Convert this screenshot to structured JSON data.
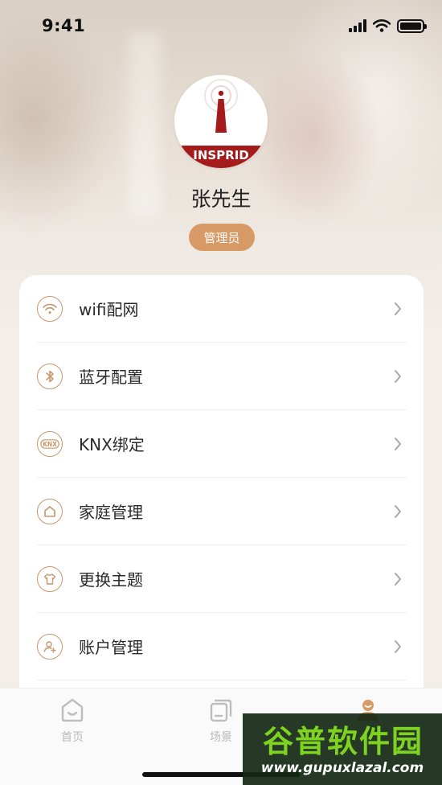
{
  "status_bar": {
    "time": "9:41"
  },
  "profile": {
    "avatar_logo_text": "INSPRID",
    "name": "张先生",
    "role": "管理员"
  },
  "menu": {
    "items": [
      {
        "label": "wifi配网",
        "icon": "wifi-icon"
      },
      {
        "label": "蓝牙配置",
        "icon": "bluetooth-icon"
      },
      {
        "label": "KNX绑定",
        "icon": "knx-icon"
      },
      {
        "label": "家庭管理",
        "icon": "home-icon"
      },
      {
        "label": "更换主题",
        "icon": "shirt-icon"
      },
      {
        "label": "账户管理",
        "icon": "user-add-icon"
      }
    ]
  },
  "tab_bar": {
    "tabs": [
      {
        "label": "首页",
        "icon": "home-tab-icon"
      },
      {
        "label": "场景",
        "icon": "scene-tab-icon"
      },
      {
        "label": "",
        "icon": "profile-tab-icon"
      }
    ]
  },
  "watermark": {
    "title": "谷普软件园",
    "url": "www.gupuxlazal.com"
  },
  "colors": {
    "accent": "#d79a66",
    "icon_stroke": "#c9956b",
    "tab_inactive": "#b9b9b9",
    "watermark_green": "#7ed321"
  }
}
